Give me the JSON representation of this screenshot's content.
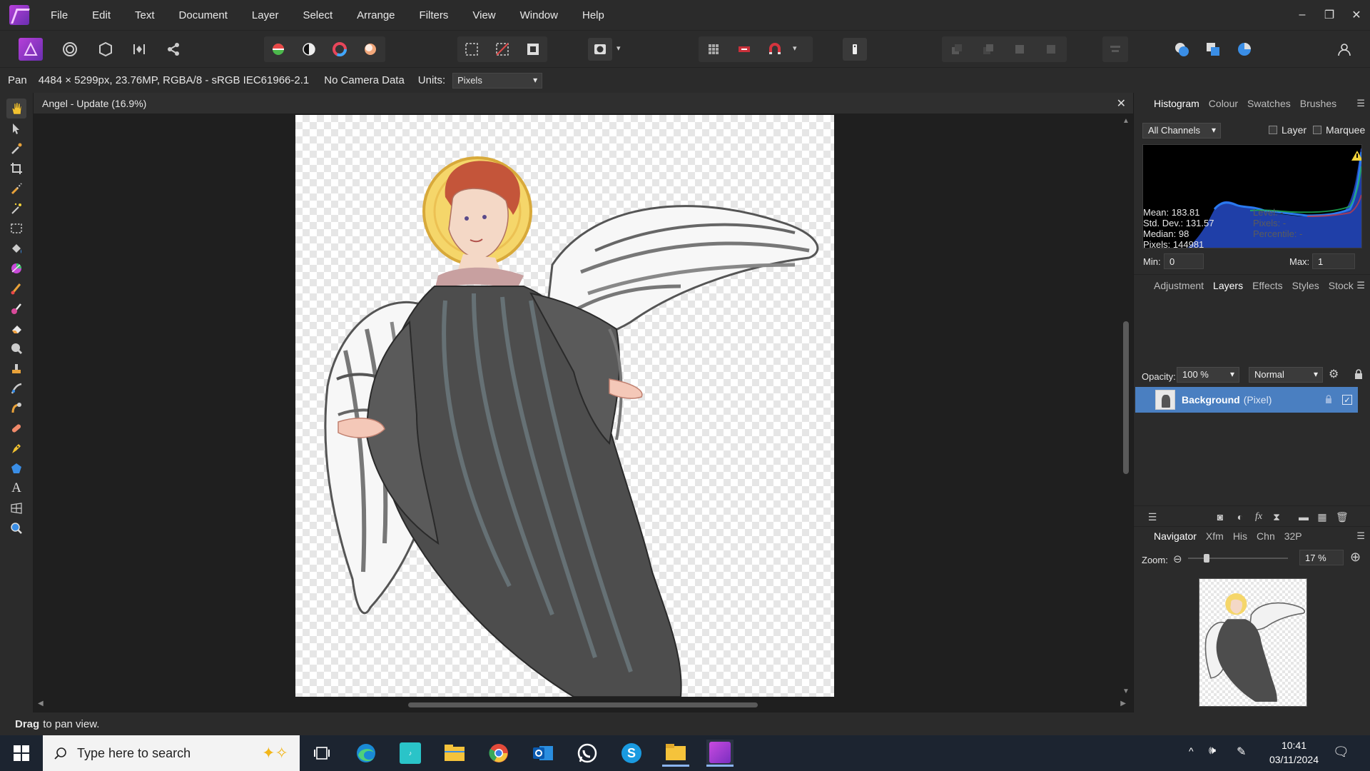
{
  "menu": {
    "items": [
      "File",
      "Edit",
      "Text",
      "Document",
      "Layer",
      "Select",
      "Arrange",
      "Filters",
      "View",
      "Window",
      "Help"
    ]
  },
  "window_controls": {
    "minimize": "–",
    "restore": "❐",
    "close": "✕"
  },
  "context": {
    "tool": "Pan",
    "doc_info": "4484 × 5299px, 23.76MP, RGBA/8 - sRGB IEC61966-2.1",
    "camera": "No Camera Data",
    "units_label": "Units:",
    "units_value": "Pixels"
  },
  "document": {
    "title": "Angel - Update (16.9%)",
    "close": "✕"
  },
  "status": {
    "bold": "Drag",
    "text": "to pan view."
  },
  "histogram_panel": {
    "tabs": [
      "Histogram",
      "Colour",
      "Swatches",
      "Brushes"
    ],
    "channel": "All Channels",
    "layer_label": "Layer",
    "marquee_label": "Marquee",
    "stats": {
      "mean": "Mean: 183.81",
      "stddev": "Std. Dev.: 131.57",
      "median": "Median: 98",
      "pixels": "Pixels: 144981",
      "level": "Level: -",
      "pixels_sel": "Pixels: -",
      "percentile": "Percentile: -"
    },
    "min_label": "Min:",
    "min_value": "0",
    "max_label": "Max:",
    "max_value": "1"
  },
  "layers_panel": {
    "tabs": [
      "Adjustment",
      "Layers",
      "Effects",
      "Styles",
      "Stock"
    ],
    "opacity_label": "Opacity:",
    "opacity_value": "100 %",
    "blend_mode": "Normal",
    "layer": {
      "name": "Background",
      "kind": "(Pixel)"
    }
  },
  "navigator_panel": {
    "tabs": [
      "Navigator",
      "Xfm",
      "His",
      "Chn",
      "32P"
    ],
    "zoom_label": "Zoom:",
    "zoom_value": "17 %",
    "zoom_fraction": 0.17
  },
  "taskbar": {
    "search_placeholder": "Type here to search",
    "time": "10:41",
    "date": "03/11/2024"
  },
  "colors": {
    "accent": "#4a7fc1",
    "panel": "#2b2b2b",
    "canvas": "#1f1f1f",
    "app_purple": "#b63fd9"
  }
}
